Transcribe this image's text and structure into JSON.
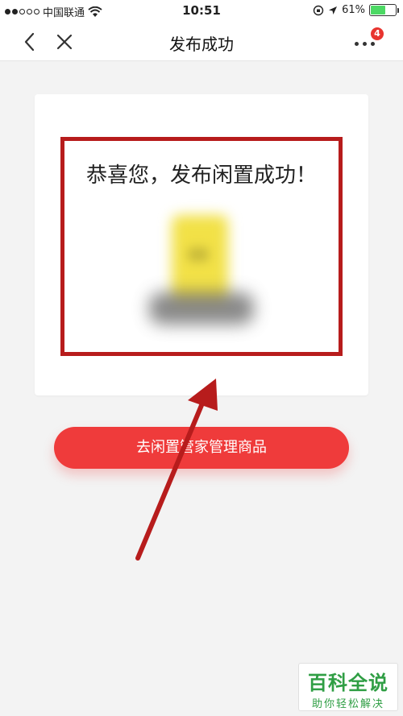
{
  "status_bar": {
    "carrier": "中国联通",
    "time": "10:51",
    "battery": "61%",
    "battery_level": 0.61
  },
  "nav": {
    "title": "发布成功",
    "badge_count": "4",
    "icons": [
      "chevron-left-icon",
      "close-icon",
      "more-icon"
    ]
  },
  "card": {
    "success_message": "恭喜您，发布闲置成功！"
  },
  "action": {
    "label": "去闲置管家管理商品"
  },
  "colors": {
    "accent": "#ef3b3b",
    "highlight": "#b71c1c",
    "badge": "#e8342f",
    "battery": "#4cd964",
    "watermark": "#2f9e44"
  },
  "watermark": {
    "title": "百科全说",
    "subtitle": "助你轻松解决"
  }
}
